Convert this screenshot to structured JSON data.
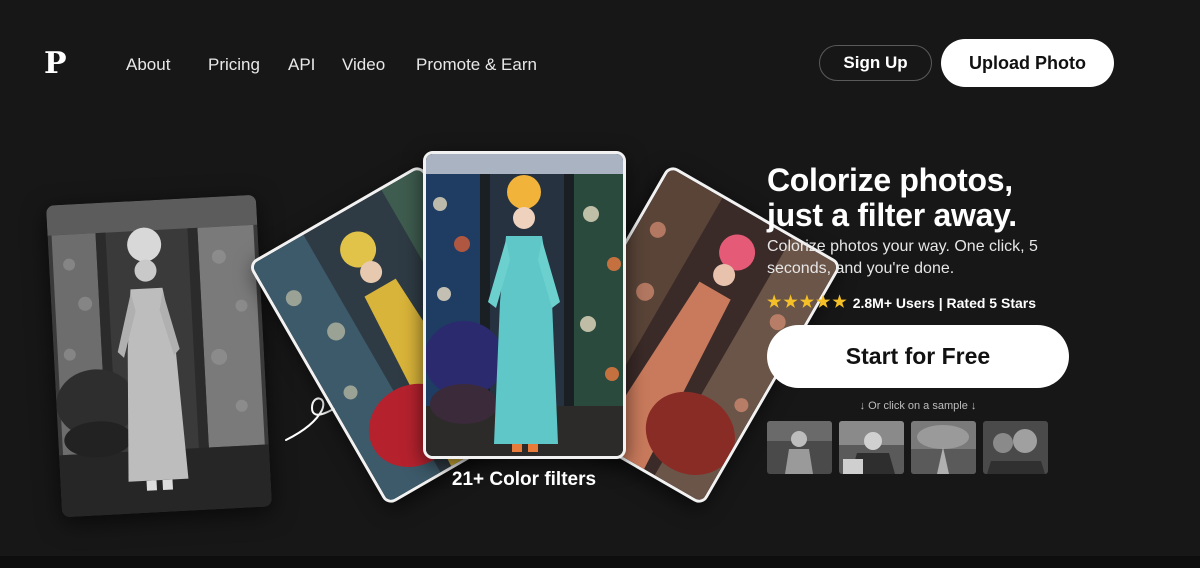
{
  "brand": {
    "logo_letter": "P"
  },
  "nav": {
    "links": [
      "About",
      "Pricing",
      "API",
      "Video",
      "Promote & Earn"
    ]
  },
  "header": {
    "signup_label": "Sign Up",
    "upload_label": "Upload Photo"
  },
  "gallery": {
    "caption": "21+ Color filters"
  },
  "hero": {
    "title_line1": "Colorize photos,",
    "title_line2": "just a filter away.",
    "subtitle": "Colorize photos your way. One click, 5 seconds, and you're done.",
    "rating_stars": 5,
    "rating_text": "2.8M+ Users | Rated 5 Stars",
    "cta_label": "Start for Free",
    "sample_hint": "↓ Or click on a sample ↓"
  },
  "colors": {
    "background": "#171717",
    "accent_star": "#f5c027",
    "button_bg": "#ffffff"
  }
}
